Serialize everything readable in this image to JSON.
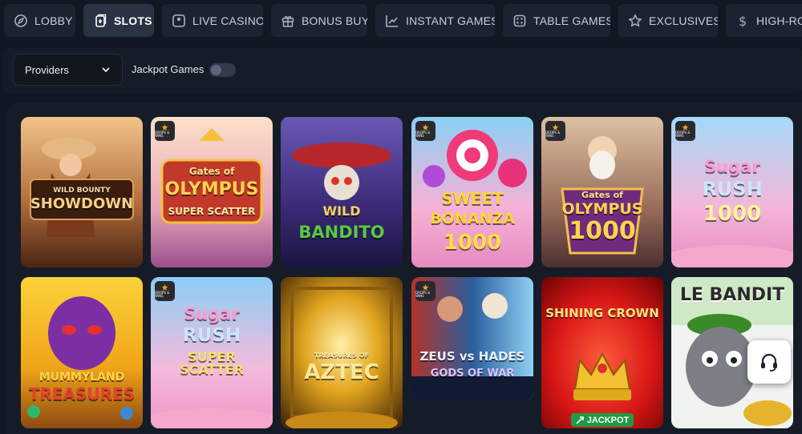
{
  "nav": {
    "items": [
      {
        "label": "LOBBY",
        "icon": "compass-icon",
        "active": false
      },
      {
        "label": "SLOTS",
        "icon": "cards-icon",
        "active": true
      },
      {
        "label": "LIVE CASINO",
        "icon": "live-icon",
        "active": false
      },
      {
        "label": "BONUS BUY",
        "icon": "gift-icon",
        "active": false
      },
      {
        "label": "INSTANT GAMES",
        "icon": "chart-up-icon",
        "active": false
      },
      {
        "label": "TABLE GAMES",
        "icon": "dice-icon",
        "active": false
      },
      {
        "label": "EXCLUSIVES",
        "icon": "star-icon",
        "active": false
      },
      {
        "label": "HIGH-ROL",
        "icon": "dollar-icon",
        "active": false
      }
    ]
  },
  "filters": {
    "providers_label": "Providers",
    "jackpot_label": "Jackpot Games",
    "jackpot_on": false
  },
  "games": [
    {
      "title": "WILD BOUNTY SHOWDOWN",
      "badge": false,
      "colors": [
        "#c8874a",
        "#6e3a1a"
      ]
    },
    {
      "title": "GATES OF OLYMPUS SUPER SCATTER",
      "badge": true,
      "colors": [
        "#f3c9a8",
        "#b05a8a"
      ]
    },
    {
      "title": "WILD BANDITO",
      "badge": false,
      "colors": [
        "#7a4fa8",
        "#2f1f5c"
      ]
    },
    {
      "title": "SWEET BONANZA 1000",
      "badge": true,
      "colors": [
        "#86c9f2",
        "#f39ad1"
      ]
    },
    {
      "title": "GATES OF OLYMPUS 1000",
      "badge": true,
      "colors": [
        "#caa57e",
        "#6b4a3a"
      ]
    },
    {
      "title": "SUGAR RUSH 1000",
      "badge": true,
      "colors": [
        "#9fd4f7",
        "#f2a7d2"
      ]
    },
    {
      "title": "MUMMYLAND TREASURES",
      "badge": false,
      "colors": [
        "#f2b21f",
        "#6d2a8a"
      ]
    },
    {
      "title": "SUGAR RUSH SUPER SCATTER",
      "badge": true,
      "colors": [
        "#8fcdf4",
        "#f2b0d9"
      ]
    },
    {
      "title": "TREASURES OF AZTEC",
      "badge": false,
      "colors": [
        "#c98a16",
        "#3c2508"
      ]
    },
    {
      "title": "ZEUS VS HADES GODS OF WAR",
      "badge": true,
      "colors": [
        "#2f6ea8",
        "#101a33"
      ]
    },
    {
      "title": "SHINING CROWN",
      "badge": false,
      "colors": [
        "#e82424",
        "#8a0b0b"
      ],
      "jackpot": "JACKPOT"
    },
    {
      "title": "LE BANDIT",
      "badge": false,
      "colors": [
        "#8fcf79",
        "#e8efe9"
      ]
    }
  ],
  "tile_labels": {
    "t0a": "WILD BOUNTY",
    "t0b": "SHOWDOWN",
    "t1a": "Gates of",
    "t1b": "OLYMPUS",
    "t1c": "SUPER SCATTER",
    "t2a": "WILD",
    "t2b": "BANDITO",
    "t3a": "SWEET",
    "t3b": "BONANZA",
    "t3c": "1000",
    "t4a": "Gates of",
    "t4b": "OLYMPUS",
    "t4c": "1000",
    "t5a": "Sugar",
    "t5b": "RUSH",
    "t5c": "1000",
    "t6a": "MUMMYLAND",
    "t6b": "TREASURES",
    "t7a": "Sugar",
    "t7b": "RUSH",
    "t7c": "SUPER SCATTER",
    "t8a": "TREASURES OF",
    "t8b": "AZTEC",
    "t9a": "ZEUS vs HADES",
    "t9b": "GODS OF WAR",
    "t10a": "SHINING CROWN",
    "t11a": "LE BANDIT"
  },
  "badge_text": "DROPS & WINS",
  "support_icon": "headset-icon"
}
